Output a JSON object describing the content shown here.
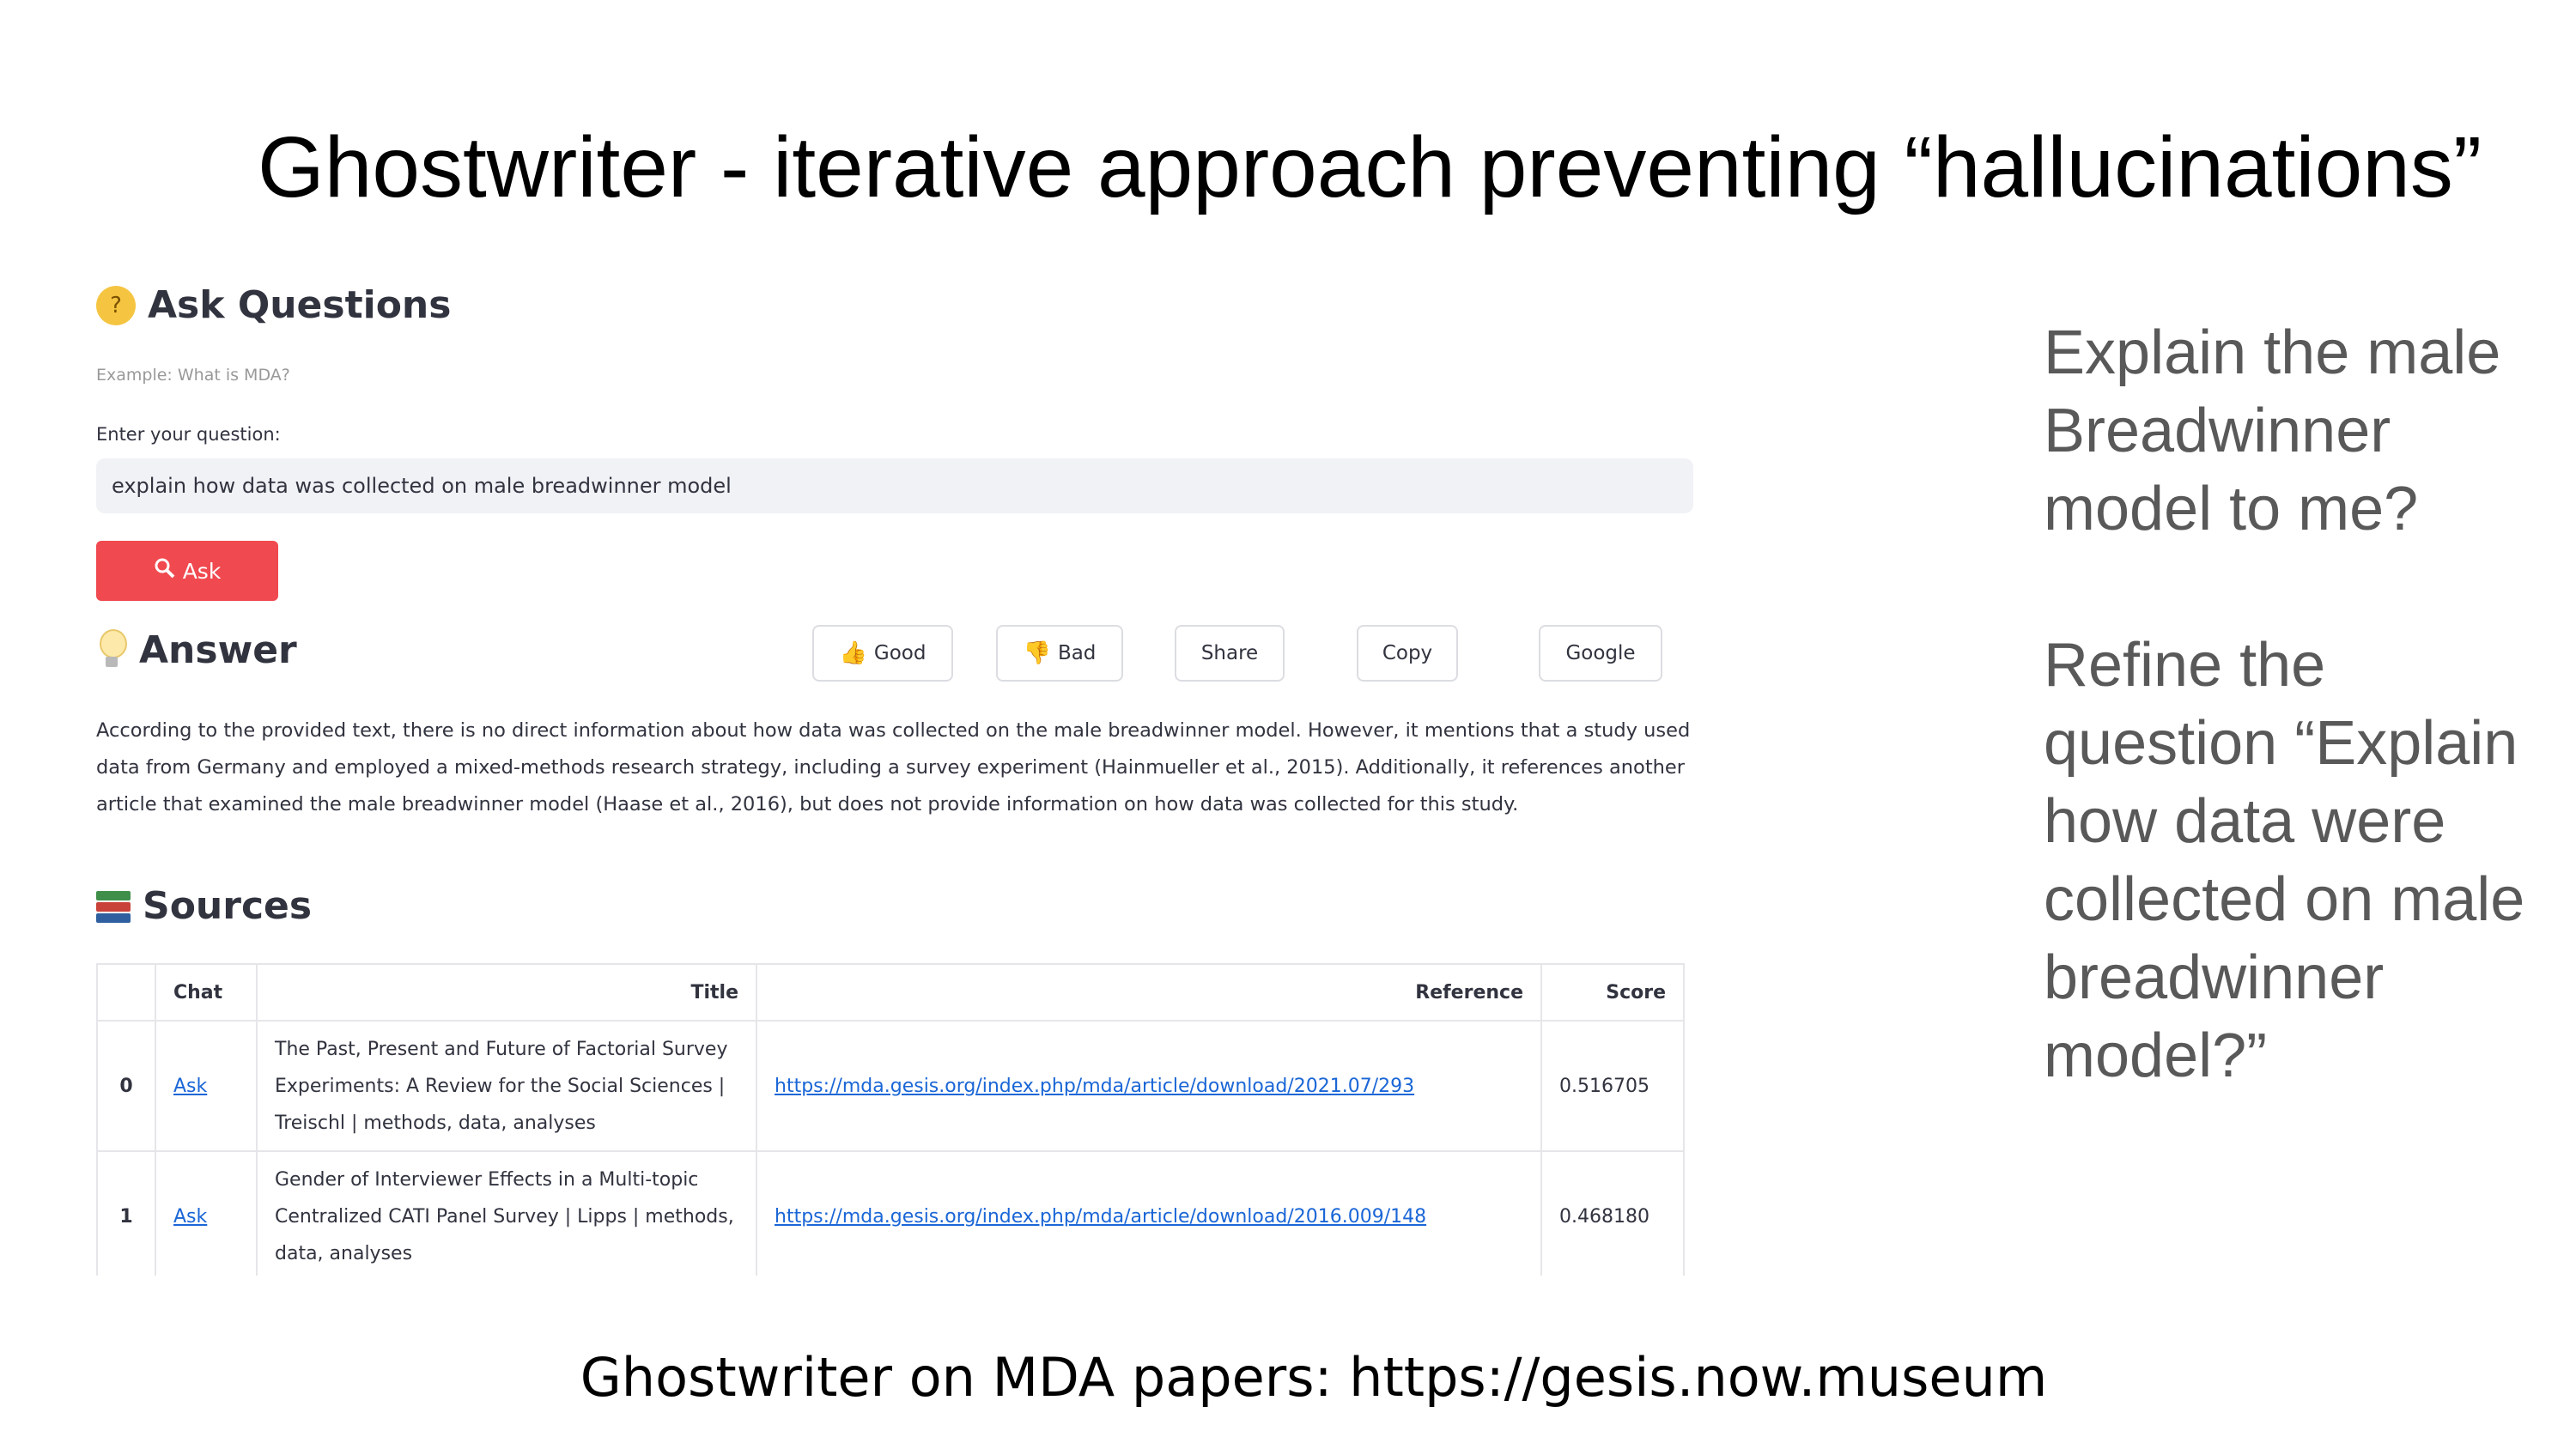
{
  "slide": {
    "title": "Ghostwriter - iterative approach preventing “hallucinations”",
    "footer": "Ghostwriter on MDA papers: https://gesis.now.museum",
    "right_note_1": "Explain the male Breadwinner model to me?",
    "right_note_2": "Refine the question “Explain how data were collected on male breadwinner model?”"
  },
  "app": {
    "ask_heading": "Ask Questions",
    "example_text": "Example: What is MDA?",
    "question_label": "Enter your question:",
    "question_value": "explain how data was collected on male breadwinner model",
    "ask_button": "Ask",
    "answer_heading": "Answer",
    "feedback": {
      "good": "Good",
      "bad": "Bad",
      "share": "Share",
      "copy": "Copy",
      "google": "Google"
    },
    "answer_text": "According to the provided text, there is no direct information about how data was collected on the male breadwinner model. However, it mentions that a study used data from Germany and employed a mixed-methods research strategy, including a survey experiment (Hainmueller et al., 2015). Additionally, it references another article that examined the male breadwinner model (Haase et al., 2016), but does not provide information on how data was collected for this study.",
    "sources_heading": "Sources",
    "table": {
      "headers": [
        "",
        "Chat",
        "Title",
        "Reference",
        "Score"
      ],
      "rows": [
        {
          "index": "0",
          "chat": "Ask",
          "title": "The Past, Present and Future of Factorial Survey Experiments: A Review for the Social Sciences | Treischl | methods, data, analyses",
          "reference": "https://mda.gesis.org/index.php/mda/article/download/2021.07/293",
          "score": "0.516705"
        },
        {
          "index": "1",
          "chat": "Ask",
          "title": "Gender of Interviewer Effects in a Multi-topic Centralized CATI Panel Survey | Lipps | methods, data, analyses",
          "reference": "https://mda.gesis.org/index.php/mda/article/download/2016.009/148",
          "score": "0.468180"
        }
      ]
    }
  },
  "colors": {
    "ask_button": "#f0494f",
    "link": "#1a66d6",
    "note_text": "#595959"
  }
}
